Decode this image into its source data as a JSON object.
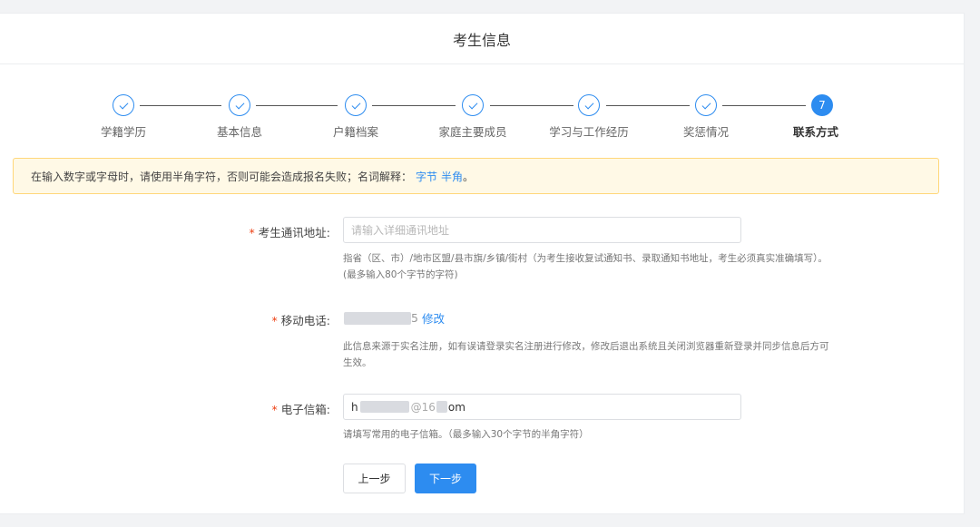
{
  "header": {
    "title": "考生信息"
  },
  "steps": [
    {
      "label": "学籍学历",
      "status": "done"
    },
    {
      "label": "基本信息",
      "status": "done"
    },
    {
      "label": "户籍档案",
      "status": "done"
    },
    {
      "label": "家庭主要成员",
      "status": "done"
    },
    {
      "label": "学习与工作经历",
      "status": "done"
    },
    {
      "label": "奖惩情况",
      "status": "done"
    },
    {
      "label": "联系方式",
      "status": "active",
      "number": "7"
    }
  ],
  "notice": {
    "text": "在输入数字或字母时，请使用半角字符，否则可能会造成报名失败；名词解释：",
    "link1": "字节",
    "link2": "半角",
    "end": "。"
  },
  "form": {
    "address": {
      "label": "考生通讯地址:",
      "placeholder": "请输入详细通讯地址",
      "help_line1": "指省（区、市）/地市区盟/县市旗/乡镇/街村（为考生接收复试通知书、录取通知书地址，考生必须真实准确填写）。",
      "help_line2": "(最多输入80个字节的字符)"
    },
    "phone": {
      "label": "移动电话:",
      "value_tail": "5",
      "modify": "修改",
      "help_line1": "此信息来源于实名注册，如有误请登录实名注册进行修改，修改后退出系统且关闭浏览器重新登录并同步信息后方可",
      "help_line2": "生效。"
    },
    "email": {
      "label": "电子信箱:",
      "value_head": "h",
      "value_mid": "@16",
      "value_tail": "om",
      "help": "请填写常用的电子信箱。（最多输入30个字节的半角字符）"
    }
  },
  "buttons": {
    "prev": "上一步",
    "next": "下一步"
  },
  "colors": {
    "primary": "#2d8cf0",
    "required": "#ed4014",
    "notice_bg": "#fff9e6",
    "notice_border": "#ffd77a"
  }
}
